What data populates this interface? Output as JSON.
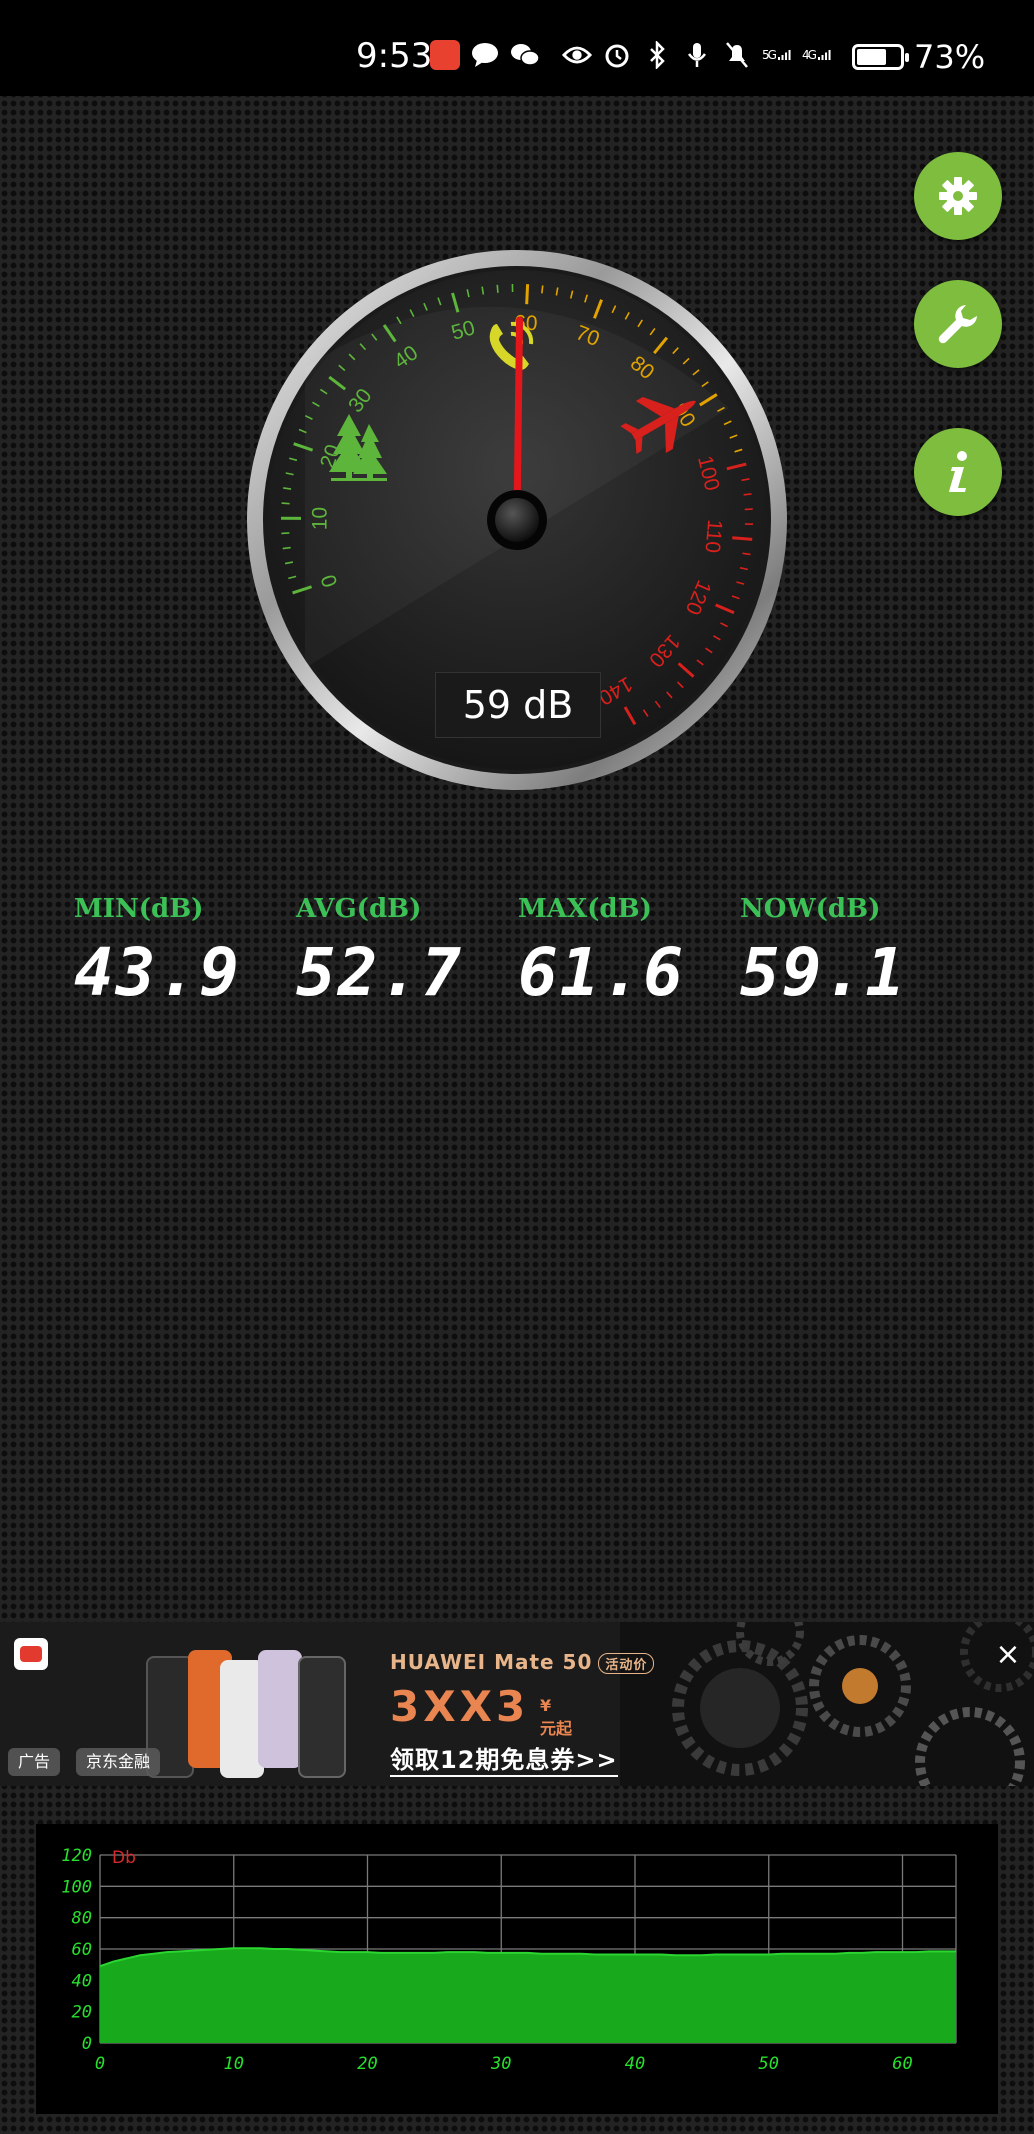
{
  "status_bar": {
    "time": "9:53",
    "network_5g": "5G",
    "network_4g": "4G",
    "battery_percent": "73%",
    "battery_level": 0.73,
    "icons": [
      "app-notification-icon",
      "chat-bubble-icon",
      "wechat-icon",
      "eye-icon",
      "alarm-icon",
      "bluetooth-icon",
      "microphone-icon",
      "mute-icon",
      "signal-5g-icon",
      "signal-4g-icon",
      "battery-icon"
    ]
  },
  "side_buttons": [
    {
      "icon": "gear-icon"
    },
    {
      "icon": "wrench-icon"
    },
    {
      "icon": "info-icon"
    }
  ],
  "gauge": {
    "tick_labels": [
      "0",
      "10",
      "20",
      "30",
      "40",
      "50",
      "60",
      "70",
      "80",
      "90",
      "100",
      "110",
      "120",
      "130",
      "140"
    ],
    "min": 0,
    "max": 140,
    "needle_value": 59,
    "readout": "59 dB",
    "icons": [
      "trees-icon",
      "phone-icon",
      "airplane-icon"
    ],
    "colors": {
      "low": "#5db53c",
      "mid": "#e2a300",
      "high": "#d8201c",
      "needle": "#e3161b"
    }
  },
  "stats": [
    {
      "label": "MIN(dB)",
      "value": "43.9"
    },
    {
      "label": "AVG(dB)",
      "value": "52.7"
    },
    {
      "label": "MAX(dB)",
      "value": "61.6"
    },
    {
      "label": "NOW(dB)",
      "value": "59.1"
    }
  ],
  "ad": {
    "headline": "HUAWEI Mate 50",
    "badge": "活动价",
    "price": "3XX3",
    "price_currency": "¥",
    "price_suffix": "元起",
    "cta": "领取12期免息券>>",
    "tags": [
      "广告",
      "京东金融"
    ],
    "close": "×"
  },
  "chart_data": {
    "type": "area",
    "ylabel": "Db",
    "ylim": [
      0,
      120
    ],
    "xlim": [
      0,
      64
    ],
    "y_ticks": [
      "0",
      "20",
      "40",
      "60",
      "80",
      "100",
      "120"
    ],
    "x_ticks": [
      "0",
      "10",
      "20",
      "30",
      "40",
      "50",
      "60"
    ],
    "x": [
      0,
      1,
      2,
      3,
      4,
      5,
      6,
      7,
      8,
      9,
      10,
      11,
      12,
      13,
      14,
      15,
      16,
      17,
      18,
      19,
      20,
      21,
      22,
      23,
      24,
      25,
      26,
      27,
      28,
      29,
      30,
      31,
      32,
      33,
      34,
      35,
      36,
      37,
      38,
      39,
      40,
      41,
      42,
      43,
      44,
      45,
      46,
      47,
      48,
      49,
      50,
      51,
      52,
      53,
      54,
      55,
      56,
      57,
      58,
      59,
      60,
      61,
      62,
      63,
      64
    ],
    "y": [
      49,
      52,
      54,
      56,
      57,
      58,
      58.5,
      59,
      59.5,
      60,
      60.5,
      60.5,
      60.5,
      60,
      60,
      59.5,
      59,
      58.5,
      58,
      58,
      58,
      57.5,
      57.5,
      57.5,
      57.5,
      57.5,
      58,
      58,
      58,
      57.5,
      57.5,
      57.5,
      57.5,
      57,
      57,
      57,
      57,
      56.5,
      56.5,
      56.5,
      56.5,
      56.5,
      56.5,
      56,
      56,
      56,
      56.5,
      56.5,
      56.5,
      56.5,
      56.5,
      57,
      57,
      57,
      57,
      57,
      57.5,
      57.5,
      58,
      58,
      58,
      58,
      58.5,
      58.5,
      58.5
    ],
    "grid": true,
    "colors": {
      "fill": "#19a91d",
      "line": "#2ad62f",
      "axis_text": "#27e02d",
      "ylabel": "#d62a2a",
      "grid": "#7a7a7a"
    }
  }
}
